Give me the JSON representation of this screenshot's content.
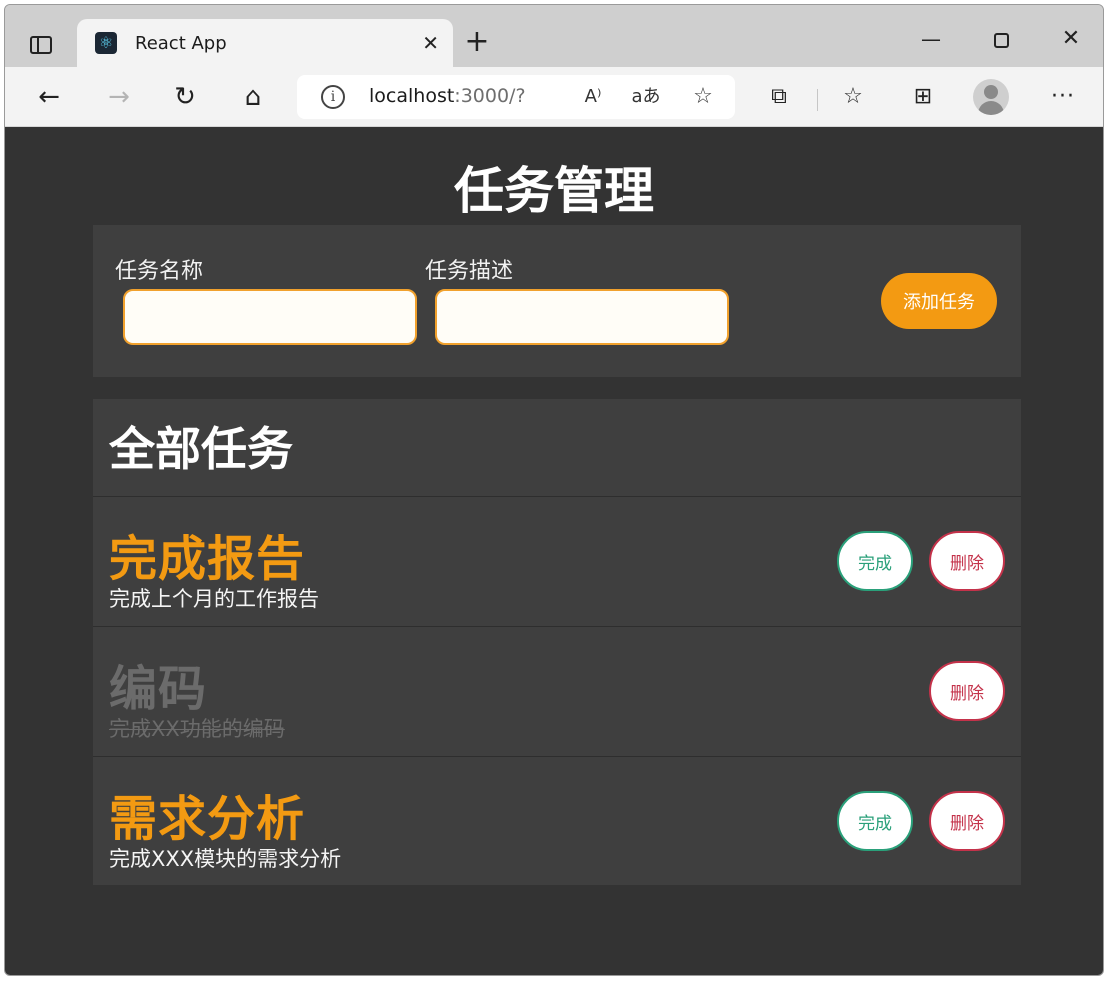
{
  "browser": {
    "tab": {
      "title": "React App"
    },
    "address": {
      "host": "localhost",
      "rest": ":3000/?"
    },
    "glyphs": {
      "new_tab": "+",
      "close_tab": "✕",
      "minimize": "—",
      "close_window": "✕",
      "back": "←",
      "forward": "→",
      "reload": "↻",
      "home": "⌂",
      "info": "i",
      "read_aloud": "A⁾",
      "translate": "aあ",
      "favorite_add": "☆",
      "extensions": "⧉",
      "favorites": "☆",
      "collections": "⊞",
      "more": "···"
    }
  },
  "page": {
    "title": "任务管理",
    "form": {
      "name_label": "任务名称",
      "name_value": "",
      "desc_label": "任务描述",
      "desc_value": "",
      "add_button": "添加任务"
    },
    "list": {
      "title": "全部任务",
      "complete_label": "完成",
      "delete_label": "删除",
      "tasks": [
        {
          "title": "完成报告",
          "description": "完成上个月的工作报告",
          "done": false
        },
        {
          "title": "编码",
          "description": "完成XX功能的编码",
          "done": true
        },
        {
          "title": "需求分析",
          "description": "完成XXX模块的需求分析",
          "done": false
        }
      ]
    }
  },
  "colors": {
    "page_bg": "#333333",
    "panel_bg": "#3f3f3f",
    "accent": "#f39a12",
    "complete": "#2aa07a",
    "delete": "#c4324a",
    "done_text": "#6b6b6b"
  }
}
